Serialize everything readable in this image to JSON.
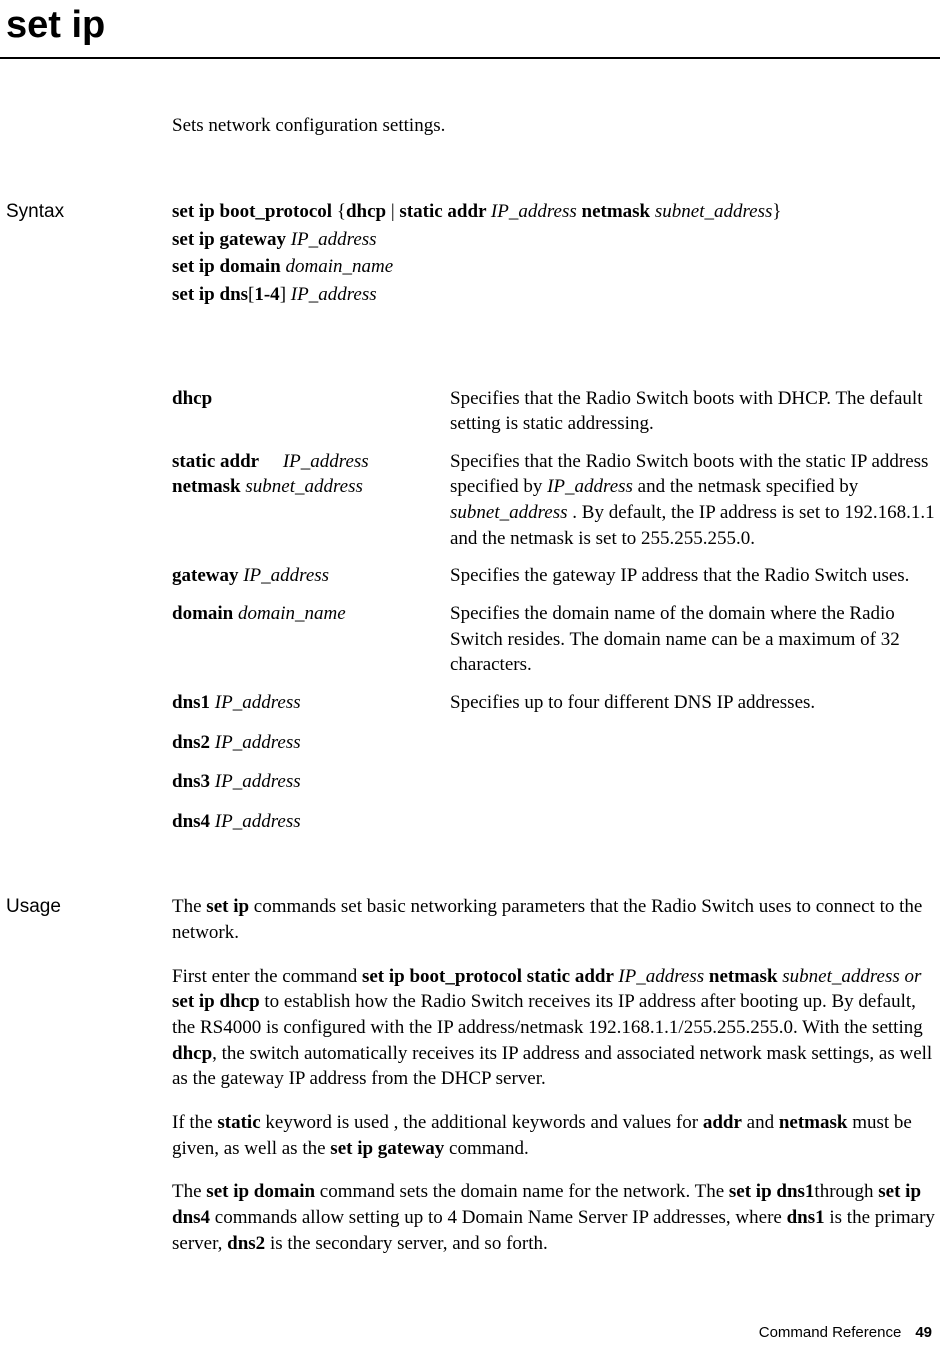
{
  "title": "set ip",
  "intro": "Sets network configuration settings.",
  "sections": {
    "syntax_label": "Syntax",
    "usage_label": "Usage"
  },
  "syntax": {
    "line1": {
      "a": "set ip boot_protocol ",
      "b": "{",
      "c": "dhcp",
      "d": " | ",
      "e": "static addr ",
      "f": "IP_address ",
      "g": "netmask ",
      "h": "subnet_address",
      "i": "}"
    },
    "line2": {
      "a": "set ip gateway ",
      "b": "IP_address"
    },
    "line3": {
      "a": "set ip domain ",
      "b": "domain_name"
    },
    "line4": {
      "a": "set ip dns",
      "b": "[",
      "c": "1-4",
      "d": "] ",
      "e": "IP_address"
    }
  },
  "params": {
    "dhcp": {
      "term": " dhcp",
      "desc": "Specifies that the Radio Switch boots with DHCP. The default setting is static addressing."
    },
    "static": {
      "term_a": "static addr",
      "term_gap": "     ",
      "term_b": "IP_address ",
      "term_c": "netmask ",
      "term_d": "subnet_address",
      "desc_a": "Specifies that the Radio Switch boots with the static IP address specified by ",
      "desc_b": "IP_address",
      "desc_c": " and the netmask specified by ",
      "desc_d": "subnet_address ",
      "desc_e": ". By default, the IP address is set to 192.168.1.1 and the netmask is set to 255.255.255.0."
    },
    "gateway": {
      "term_a": "gateway ",
      "term_b": "IP_address",
      "desc": "Specifies the gateway IP address that the Radio Switch uses."
    },
    "domain": {
      "term_a": "domain ",
      "term_b": "domain_name",
      "desc": "Specifies the domain name of the domain where the Radio Switch resides. The domain name can be a maximum of 32 characters."
    },
    "dns1": {
      "term_a": "dns1 ",
      "term_b": "IP_address",
      "desc": "Specifies up to four different DNS IP addresses."
    },
    "dns2": {
      "term_a": "dns2 ",
      "term_b": "IP_address"
    },
    "dns3": {
      "term_a": "dns3 ",
      "term_b": "IP_address"
    },
    "dns4": {
      "term_a": "dns4 ",
      "term_b": "IP_address"
    }
  },
  "usage": {
    "p1_a": "The ",
    "p1_b": "set ip",
    "p1_c": " commands set basic networking parameters that the Radio Switch uses to connect to the network.",
    "p2_a": "First enter the command ",
    "p2_b": "set ip boot_protocol static addr ",
    "p2_c": "IP_address ",
    "p2_d": "netmask ",
    "p2_e": "subnet_address or ",
    "p2_f": "set ip dhcp",
    "p2_g": " to establish how the Radio Switch receives its IP address after booting up. By default, the RS4000 is configured with the IP address/netmask 192.168.1.1/255.255.255.0. With the setting ",
    "p2_h": "dhcp",
    "p2_i": ", the switch automatically receives its IP address and associated network mask settings, as well as the gateway IP address from the DHCP server.",
    "p3_a": "If the ",
    "p3_b": "static",
    "p3_c": " keyword is used , the additional keywords and values for ",
    "p3_d": "addr",
    "p3_e": " and ",
    "p3_f": "netmask",
    "p3_g": " must be given, as well as the ",
    "p3_h": "set ip gateway",
    "p3_i": " command.",
    "p4_a": "The ",
    "p4_b": "set ip domain",
    "p4_c": " command sets the domain name for the network. The ",
    "p4_d": "set ip dns1",
    "p4_e": "through ",
    "p4_f": "set ip dns4",
    "p4_g": " commands allow setting up to 4 Domain Name Server IP addresses, where ",
    "p4_h": "dns1",
    "p4_i": " is the primary server, ",
    "p4_j": "dns2",
    "p4_k": " is the secondary server, and so forth."
  },
  "footer": {
    "section": "Command Reference",
    "page": "49"
  }
}
